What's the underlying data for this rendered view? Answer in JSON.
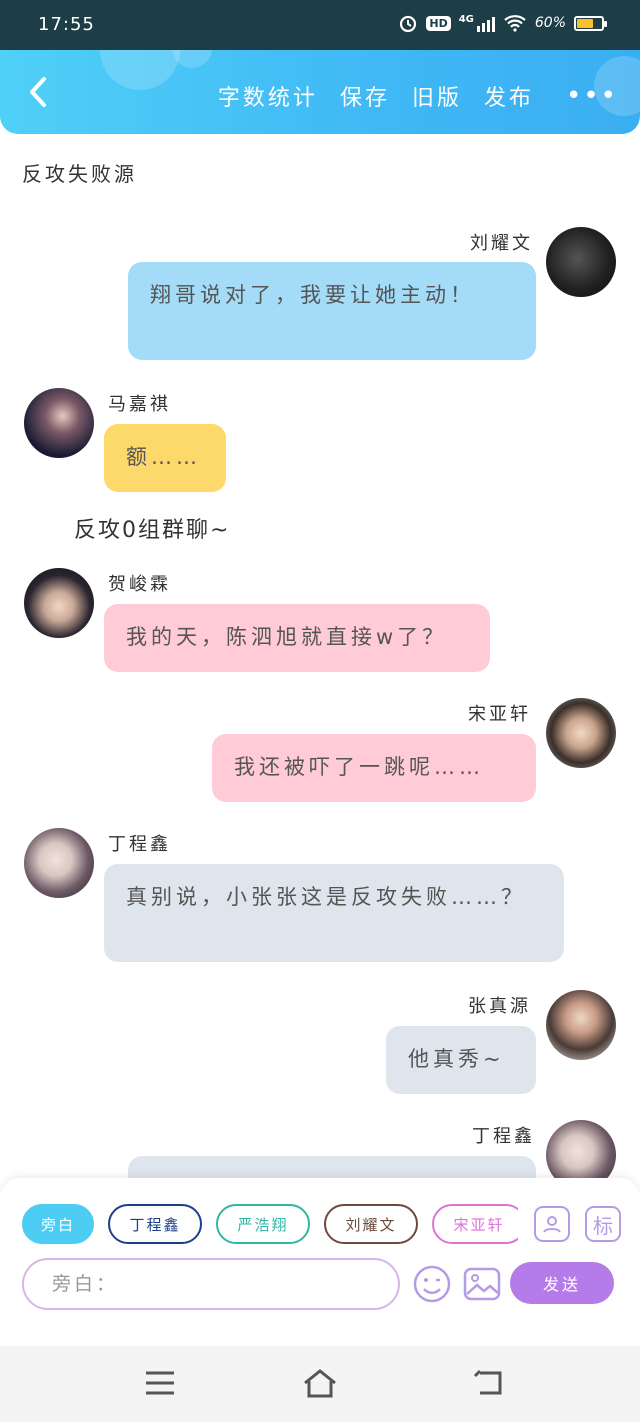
{
  "status_bar": {
    "time": "17:55",
    "network": "4G",
    "hd": "HD",
    "battery": "60%",
    "battery_level": 0.6
  },
  "header": {
    "actions": [
      "字数统计",
      "保存",
      "旧版",
      "发布"
    ],
    "more": "•••"
  },
  "chat": {
    "title": "反攻失败源",
    "narration": "反攻0组群聊~",
    "messages": [
      {
        "name": "刘耀文",
        "text": "翔哥说对了，我要让她主动！"
      },
      {
        "name": "马嘉祺",
        "text": "额……"
      },
      {
        "name": "贺峻霖",
        "text": "我的天，陈泗旭就直接w了？"
      },
      {
        "name": "宋亚轩",
        "text": "我还被吓了一跳呢……"
      },
      {
        "name": "丁程鑫",
        "text": "真别说，小张张这是反攻失败……？"
      },
      {
        "name": "张真源",
        "text": "他真秀~"
      },
      {
        "name": "丁程鑫",
        "text": ""
      }
    ]
  },
  "input_area": {
    "roles": [
      "旁白",
      "丁程鑫",
      "严浩翔",
      "刘耀文",
      "宋亚轩"
    ],
    "tool_label": "标",
    "placeholder": "旁白：",
    "send_label": "发送"
  },
  "colors": {
    "header": "#40b8f5",
    "blue_bubble": "#a4dcf8",
    "yellow_bubble": "#fdd86b",
    "pink_bubble": "#ffcbd7",
    "gray_bubble": "#dfe5ed",
    "send": "#b57be8"
  }
}
